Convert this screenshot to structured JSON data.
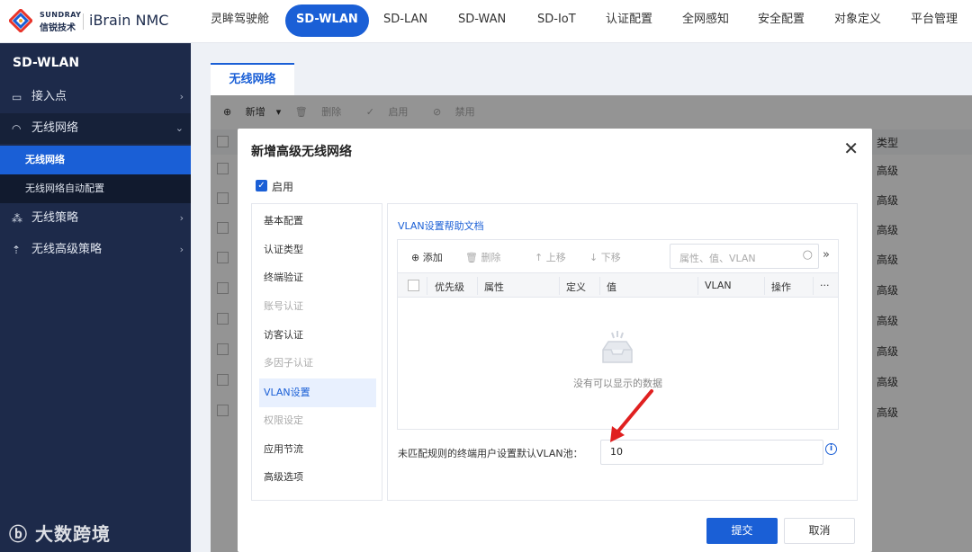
{
  "brand": {
    "en": "SUNDRAY",
    "cn": "信锐技术",
    "app": "iBrain NMC"
  },
  "nav": [
    "灵眸驾驶舱",
    "SD-WLAN",
    "SD-LAN",
    "SD-WAN",
    "SD-IoT",
    "认证配置",
    "全网感知",
    "安全配置",
    "对象定义",
    "平台管理"
  ],
  "nav_active": "SD-WLAN",
  "sidebar": {
    "title": "SD-WLAN",
    "items": [
      {
        "label": "接入点",
        "icon": "router-icon"
      },
      {
        "label": "无线网络",
        "icon": "wifi-icon"
      },
      {
        "label": "无线策略",
        "icon": "policy-icon"
      },
      {
        "label": "无线高级策略",
        "icon": "advanced-policy-icon"
      }
    ],
    "sub_items": [
      "无线网络",
      "无线网络自动配置"
    ]
  },
  "watermark": "大数跨境",
  "main": {
    "tab": "无线网络",
    "toolbar": {
      "new": "新增",
      "delete": "删除",
      "enable": "启用",
      "disable": "禁用"
    },
    "table_header_type": "类型",
    "row_values": [
      "高级",
      "高级",
      "高级",
      "高级",
      "高级",
      "高级",
      "高级",
      "高级",
      "高级"
    ]
  },
  "modal": {
    "title": "新增高级无线网络",
    "enable_label": "启用",
    "menu": [
      {
        "label": "基本配置",
        "disabled": false
      },
      {
        "label": "认证类型",
        "disabled": false
      },
      {
        "label": "终端验证",
        "disabled": false
      },
      {
        "label": "账号认证",
        "disabled": true
      },
      {
        "label": "访客认证",
        "disabled": false
      },
      {
        "label": "多因子认证",
        "disabled": true
      },
      {
        "label": "VLAN设置",
        "disabled": false,
        "active": true
      },
      {
        "label": "权限设定",
        "disabled": true
      },
      {
        "label": "应用节流",
        "disabled": false
      },
      {
        "label": "高级选项",
        "disabled": false
      }
    ],
    "help_link": "VLAN设置帮助文档",
    "inner_toolbar": {
      "add": "添加",
      "delete": "删除",
      "up": "上移",
      "down": "下移"
    },
    "search_placeholder": "属性、值、VLAN",
    "columns": [
      "优先级",
      "属性",
      "定义",
      "值",
      "VLAN",
      "操作",
      "···"
    ],
    "empty_text": "没有可以显示的数据",
    "vlan_label": "未匹配规则的终端用户设置默认VLAN池：",
    "vlan_value": "10",
    "submit": "提交",
    "cancel": "取消"
  },
  "colors": {
    "accent": "#1a5fd6",
    "sidebar": "#1d2a4a",
    "annotation_arrow": "#e02020"
  }
}
